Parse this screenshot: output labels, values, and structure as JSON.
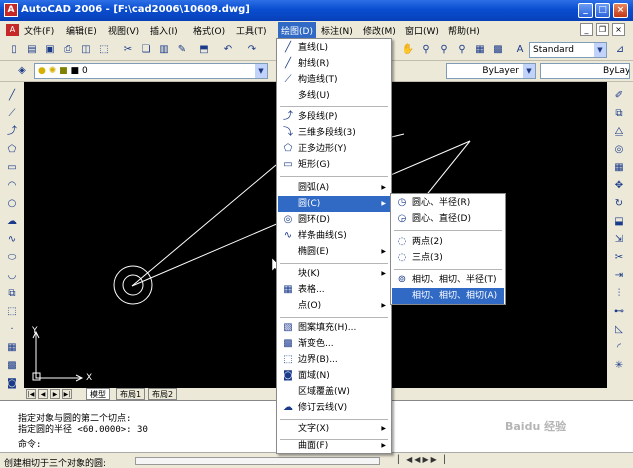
{
  "window": {
    "title": "AutoCAD 2006 - [F:\\cad2006\\10609.dwg]"
  },
  "menubar": {
    "items": [
      "文件(F)",
      "编辑(E)",
      "视图(V)",
      "插入(I)",
      "格式(O)",
      "工具(T)",
      "绘图(D)",
      "标注(N)",
      "修改(M)",
      "窗口(W)",
      "帮助(H)"
    ],
    "active_index": 6
  },
  "toolbar": {
    "text_style": "Standard",
    "layer": "0",
    "linetype": "ByLayer",
    "lineweight": "ByLayer"
  },
  "draw_menu": {
    "items": [
      {
        "label": "直线(L)",
        "icon": "line-icon"
      },
      {
        "label": "射线(R)",
        "icon": "ray-icon"
      },
      {
        "label": "构造线(T)",
        "icon": "construction-line-icon"
      },
      {
        "label": "多线(U)",
        "icon": ""
      },
      {
        "sep": true
      },
      {
        "label": "多段线(P)",
        "icon": "polyline-icon"
      },
      {
        "label": "三维多段线(3)",
        "icon": "3d-polyline-icon"
      },
      {
        "label": "正多边形(Y)",
        "icon": "polygon-icon"
      },
      {
        "label": "矩形(G)",
        "icon": "rectangle-icon"
      },
      {
        "sep": true
      },
      {
        "label": "圆弧(A)",
        "icon": "",
        "sub": true
      },
      {
        "label": "圆(C)",
        "icon": "",
        "sub": true,
        "hl": true
      },
      {
        "label": "圆环(D)",
        "icon": "donut-icon"
      },
      {
        "label": "样条曲线(S)",
        "icon": "spline-icon"
      },
      {
        "label": "椭圆(E)",
        "icon": "",
        "sub": true
      },
      {
        "sep": true
      },
      {
        "label": "块(K)",
        "icon": "",
        "sub": true
      },
      {
        "label": "表格...",
        "icon": "table-icon"
      },
      {
        "label": "点(O)",
        "icon": "",
        "sub": true
      },
      {
        "sep": true
      },
      {
        "label": "图案填充(H)...",
        "icon": "hatch-icon"
      },
      {
        "label": "渐变色...",
        "icon": "gradient-icon"
      },
      {
        "label": "边界(B)...",
        "icon": "boundary-icon"
      },
      {
        "label": "面域(N)",
        "icon": "region-icon"
      },
      {
        "label": "区域覆盖(W)",
        "icon": ""
      },
      {
        "label": "修订云线(V)",
        "icon": "revision-cloud-icon"
      },
      {
        "sep": true
      },
      {
        "label": "文字(X)",
        "icon": "",
        "sub": true
      },
      {
        "sep": true
      },
      {
        "label": "曲面(F)",
        "icon": "",
        "sub": true
      }
    ]
  },
  "circle_submenu": {
    "items": [
      {
        "label": "圆心、半径(R)",
        "icon": "circle-center-radius-icon"
      },
      {
        "label": "圆心、直径(D)",
        "icon": "circle-center-diameter-icon"
      },
      {
        "sep": true
      },
      {
        "label": "两点(2)",
        "icon": "circle-2p-icon"
      },
      {
        "label": "三点(3)",
        "icon": "circle-3p-icon"
      },
      {
        "sep": true
      },
      {
        "label": "相切、相切、半径(T)",
        "icon": "circle-ttr-icon"
      },
      {
        "label": "相切、相切、相切(A)",
        "icon": "",
        "hl": true
      }
    ]
  },
  "tabs": [
    "模型",
    "布局1",
    "布局2"
  ],
  "command": {
    "line1": "指定对象与圆的第二个切点:",
    "line2": "指定圆的半径 <60.0000>: 30",
    "prompt": "命令:"
  },
  "status": {
    "text": "创建相切于三个对象的圆:"
  },
  "axes": {
    "x": "X",
    "y": "Y"
  },
  "watermark": "Baidu 经验",
  "colors": {
    "title": "#0a4ed0",
    "highlight": "#316ac5",
    "canvas": "#000000",
    "drawing": "#ffffff"
  }
}
